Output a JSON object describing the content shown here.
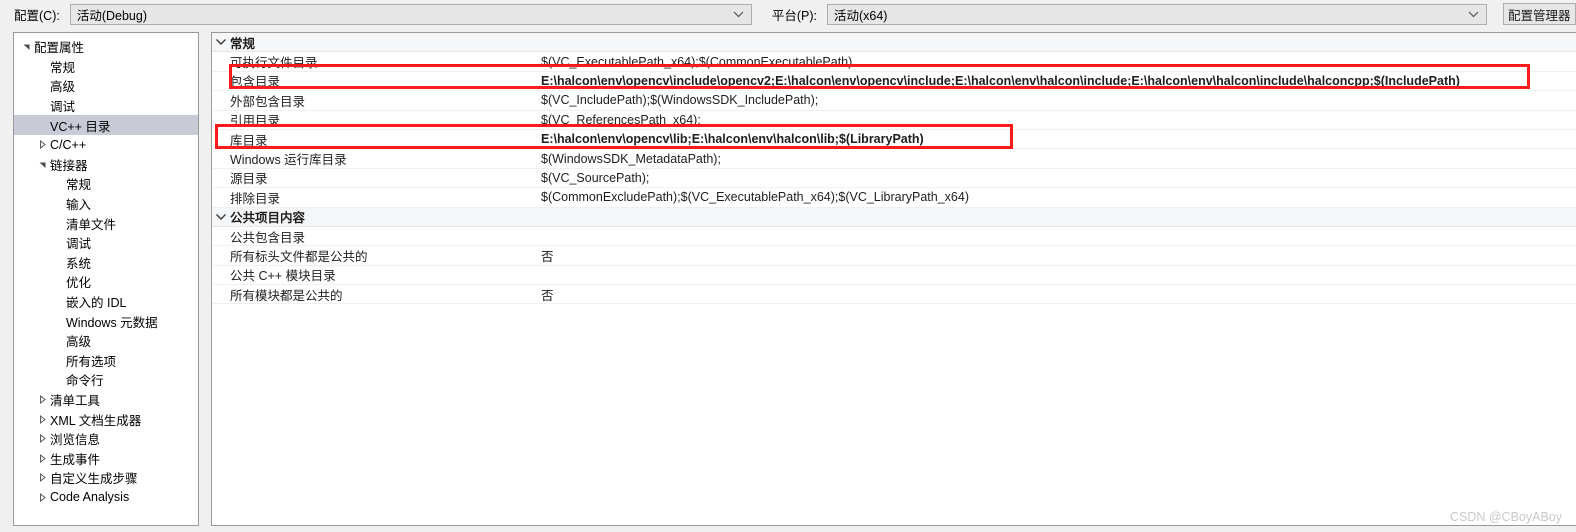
{
  "topbar": {
    "config_label": "配置(C):",
    "config_value": "活动(Debug)",
    "platform_label": "平台(P):",
    "platform_value": "活动(x64)",
    "config_manager_button": "配置管理器"
  },
  "tree": {
    "items": [
      {
        "label": "配置属性",
        "indent": 0,
        "twisty": "collapse",
        "selected": false
      },
      {
        "label": "常规",
        "indent": 1,
        "twisty": "none",
        "selected": false
      },
      {
        "label": "高级",
        "indent": 1,
        "twisty": "none",
        "selected": false
      },
      {
        "label": "调试",
        "indent": 1,
        "twisty": "none",
        "selected": false
      },
      {
        "label": "VC++ 目录",
        "indent": 1,
        "twisty": "none",
        "selected": true
      },
      {
        "label": "C/C++",
        "indent": 1,
        "twisty": "expand",
        "selected": false
      },
      {
        "label": "链接器",
        "indent": 1,
        "twisty": "collapse",
        "selected": false
      },
      {
        "label": "常规",
        "indent": 2,
        "twisty": "none",
        "selected": false
      },
      {
        "label": "输入",
        "indent": 2,
        "twisty": "none",
        "selected": false
      },
      {
        "label": "清单文件",
        "indent": 2,
        "twisty": "none",
        "selected": false
      },
      {
        "label": "调试",
        "indent": 2,
        "twisty": "none",
        "selected": false
      },
      {
        "label": "系统",
        "indent": 2,
        "twisty": "none",
        "selected": false
      },
      {
        "label": "优化",
        "indent": 2,
        "twisty": "none",
        "selected": false
      },
      {
        "label": "嵌入的 IDL",
        "indent": 2,
        "twisty": "none",
        "selected": false
      },
      {
        "label": "Windows 元数据",
        "indent": 2,
        "twisty": "none",
        "selected": false
      },
      {
        "label": "高级",
        "indent": 2,
        "twisty": "none",
        "selected": false
      },
      {
        "label": "所有选项",
        "indent": 2,
        "twisty": "none",
        "selected": false
      },
      {
        "label": "命令行",
        "indent": 2,
        "twisty": "none",
        "selected": false
      },
      {
        "label": "清单工具",
        "indent": 1,
        "twisty": "expand",
        "selected": false
      },
      {
        "label": "XML 文档生成器",
        "indent": 1,
        "twisty": "expand",
        "selected": false
      },
      {
        "label": "浏览信息",
        "indent": 1,
        "twisty": "expand",
        "selected": false
      },
      {
        "label": "生成事件",
        "indent": 1,
        "twisty": "expand",
        "selected": false
      },
      {
        "label": "自定义生成步骤",
        "indent": 1,
        "twisty": "expand",
        "selected": false
      },
      {
        "label": "Code Analysis",
        "indent": 1,
        "twisty": "expand",
        "selected": false
      }
    ]
  },
  "grid": {
    "rows": [
      {
        "kind": "category",
        "twisty": "collapse",
        "name": "常规",
        "value": "",
        "bold": false,
        "highlight": "none"
      },
      {
        "kind": "property",
        "twisty": "none",
        "name": "可执行文件目录",
        "value": "$(VC_ExecutablePath_x64);$(CommonExecutablePath)",
        "bold": false,
        "highlight": "none"
      },
      {
        "kind": "property",
        "twisty": "none",
        "name": "包含目录",
        "value": "E:\\halcon\\env\\opencv\\include\\opencv2;E:\\halcon\\env\\opencv\\include;E:\\halcon\\env\\halcon\\include;E:\\halcon\\env\\halcon\\include\\halconcpp;$(IncludePath)",
        "bold": true,
        "highlight": "include"
      },
      {
        "kind": "property",
        "twisty": "none",
        "name": "外部包含目录",
        "value": "$(VC_IncludePath);$(WindowsSDK_IncludePath);",
        "bold": false,
        "highlight": "none"
      },
      {
        "kind": "property",
        "twisty": "none",
        "name": "引用目录",
        "value": "$(VC_ReferencesPath_x64);",
        "bold": false,
        "highlight": "none"
      },
      {
        "kind": "property",
        "twisty": "none",
        "name": "库目录",
        "value": "E:\\halcon\\env\\opencv\\lib;E:\\halcon\\env\\halcon\\lib;$(LibraryPath)",
        "bold": true,
        "highlight": "library"
      },
      {
        "kind": "property",
        "twisty": "none",
        "name": "Windows 运行库目录",
        "value": "$(WindowsSDK_MetadataPath);",
        "bold": false,
        "highlight": "none"
      },
      {
        "kind": "property",
        "twisty": "none",
        "name": "源目录",
        "value": "$(VC_SourcePath);",
        "bold": false,
        "highlight": "none"
      },
      {
        "kind": "property",
        "twisty": "none",
        "name": "排除目录",
        "value": "$(CommonExcludePath);$(VC_ExecutablePath_x64);$(VC_LibraryPath_x64)",
        "bold": false,
        "highlight": "none"
      },
      {
        "kind": "category",
        "twisty": "collapse",
        "name": "公共项目内容",
        "value": "",
        "bold": false,
        "highlight": "none"
      },
      {
        "kind": "property",
        "twisty": "none",
        "name": "公共包含目录",
        "value": "",
        "bold": false,
        "highlight": "none"
      },
      {
        "kind": "property",
        "twisty": "none",
        "name": "所有标头文件都是公共的",
        "value": "否",
        "bold": false,
        "highlight": "none"
      },
      {
        "kind": "property",
        "twisty": "none",
        "name": "公共 C++ 模块目录",
        "value": "",
        "bold": false,
        "highlight": "none"
      },
      {
        "kind": "property",
        "twisty": "none",
        "name": "所有模块都是公共的",
        "value": "否",
        "bold": false,
        "highlight": "none"
      }
    ]
  },
  "colors": {
    "highlight_red": "#ff1a1a",
    "selection_blue_grey": "#c8cbd6",
    "category_bg": "#f4f6f8"
  },
  "watermark": "CSDN @CBoyABoy"
}
